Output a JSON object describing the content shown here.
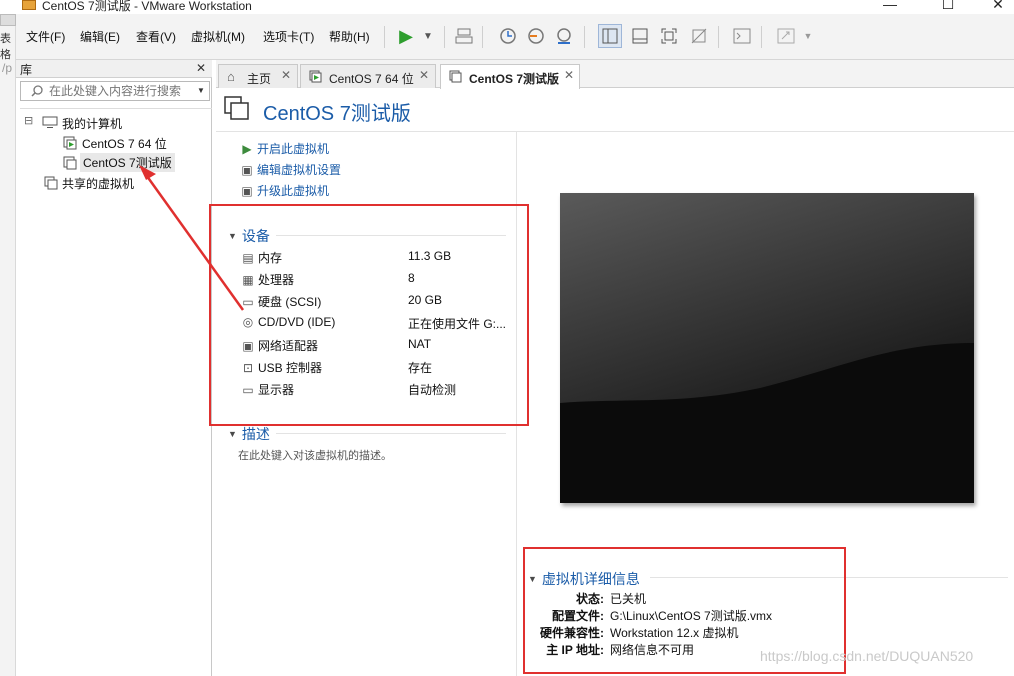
{
  "window": {
    "title": "CentOS 7测试版 - VMware Workstation",
    "min_glyph": "—",
    "max_glyph": "☐",
    "close_glyph": "✕"
  },
  "bg_strip": {
    "text1": "表格",
    "text2": "/p"
  },
  "menu": [
    {
      "label": "文件(F)"
    },
    {
      "label": "编辑(E)"
    },
    {
      "label": "查看(V)"
    },
    {
      "label": "虚拟机(M)"
    },
    {
      "label": "选项卡(T)"
    },
    {
      "label": "帮助(H)"
    }
  ],
  "toolbar_icons": [
    "play-icon",
    "dropdown-icon",
    "send-keys-icon",
    "snapshot-icon",
    "revert-snapshot-icon",
    "snapshot-manager-icon",
    "sidebar-view-icon",
    "thumbnail-view-icon",
    "fullscreen-icon",
    "unity-icon",
    "console-icon",
    "stretch-icon"
  ],
  "library": {
    "title": "库",
    "close_glyph": "✕",
    "search_placeholder": "在此处键入内容进行搜索",
    "tree": {
      "root_label": "我的计算机",
      "expander": "⊟",
      "vm1": "CentOS 7 64 位",
      "vm2": "CentOS 7测试版",
      "shared": "共享的虚拟机"
    }
  },
  "tabs": [
    {
      "label": "主页",
      "icon": "home-icon"
    },
    {
      "label": "CentOS 7 64 位",
      "icon": "vm-icon"
    },
    {
      "label": "CentOS 7测试版",
      "icon": "vm-icon"
    }
  ],
  "tab_close_glyph": "✕",
  "vm": {
    "name": "CentOS 7测试版",
    "actions": {
      "power_on": "开启此虚拟机",
      "edit_settings": "编辑虚拟机设置",
      "upgrade": "升级此虚拟机"
    },
    "devices_title": "设备",
    "devices": [
      {
        "name": "内存",
        "value": "11.3 GB",
        "icon": "memory-icon"
      },
      {
        "name": "处理器",
        "value": "8",
        "icon": "cpu-icon"
      },
      {
        "name": "硬盘 (SCSI)",
        "value": "20 GB",
        "icon": "hard-disk-icon"
      },
      {
        "name": "CD/DVD (IDE)",
        "value": "正在使用文件 G:...",
        "icon": "cd-dvd-icon"
      },
      {
        "name": "网络适配器",
        "value": "NAT",
        "icon": "network-icon"
      },
      {
        "name": "USB 控制器",
        "value": "存在",
        "icon": "usb-icon"
      },
      {
        "name": "显示器",
        "value": "自动检测",
        "icon": "display-icon"
      }
    ],
    "description_title": "描述",
    "description_placeholder": "在此处键入对该虚拟机的描述。",
    "details_title": "虚拟机详细信息",
    "details": {
      "status_label": "状态:",
      "status_value": "已关机",
      "config_label": "配置文件:",
      "config_value": "G:\\Linux\\CentOS 7测试版.vmx",
      "compat_label": "硬件兼容性:",
      "compat_value": "Workstation 12.x 虚拟机",
      "ip_label": "主 IP 地址:",
      "ip_value": "网络信息不可用"
    }
  },
  "watermark": "https://blog.csdn.net/DUQUAN520",
  "colors": {
    "accent": "#1b5ca8",
    "annotation": "#e0302f",
    "play_green": "#2e9e2e"
  }
}
